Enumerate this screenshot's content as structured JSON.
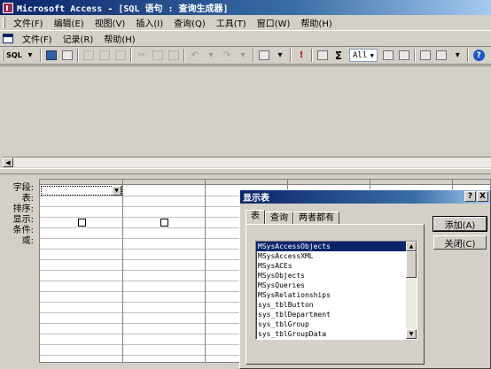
{
  "window": {
    "title": "Microsoft Access - [SQL 语句 : 查询生成器]"
  },
  "menubar": {
    "items": [
      "文件(F)",
      "编辑(E)",
      "视图(V)",
      "插入(I)",
      "查询(Q)",
      "工具(T)",
      "窗口(W)",
      "帮助(H)"
    ]
  },
  "menubar2": {
    "items": [
      "文件(F)",
      "记录(R)",
      "帮助(H)"
    ]
  },
  "toolbar": {
    "sql_label": "SQL",
    "sigma_label": "Σ",
    "top_values": "All",
    "icons": [
      "save-icon",
      "print-preview-icon",
      "print-icon",
      "spelling-icon",
      "cut-icon",
      "copy-icon",
      "paste-icon",
      "undo-icon",
      "redo-icon",
      "query-type-icon",
      "run-icon",
      "show-table-icon",
      "totals-icon",
      "properties-icon",
      "build-icon",
      "database-window-icon",
      "new-object-icon",
      "help-icon"
    ]
  },
  "grid": {
    "row_labels": [
      "字段:",
      "表:",
      "排序:",
      "显示:",
      "条件:",
      "或:"
    ]
  },
  "dialog": {
    "title": "显示表",
    "help_btn": "?",
    "close_btn": "X",
    "tabs": [
      "表",
      "查询",
      "两者都有"
    ],
    "active_tab": 0,
    "tables": [
      "MSysAccessObjects",
      "MSysAccessXML",
      "MSysACEs",
      "MSysObjects",
      "MSysQueries",
      "MSysRelationships",
      "sys_tblButton",
      "sys_tblDepartment",
      "sys_tblGroup",
      "sys_tblGroupData"
    ],
    "selected_index": 0,
    "add_button": "添加(A)",
    "close_button": "关闭(C)"
  },
  "colors": {
    "title_active": "#0a246a",
    "selection": "#0a246a",
    "face": "#d4d0c8"
  }
}
